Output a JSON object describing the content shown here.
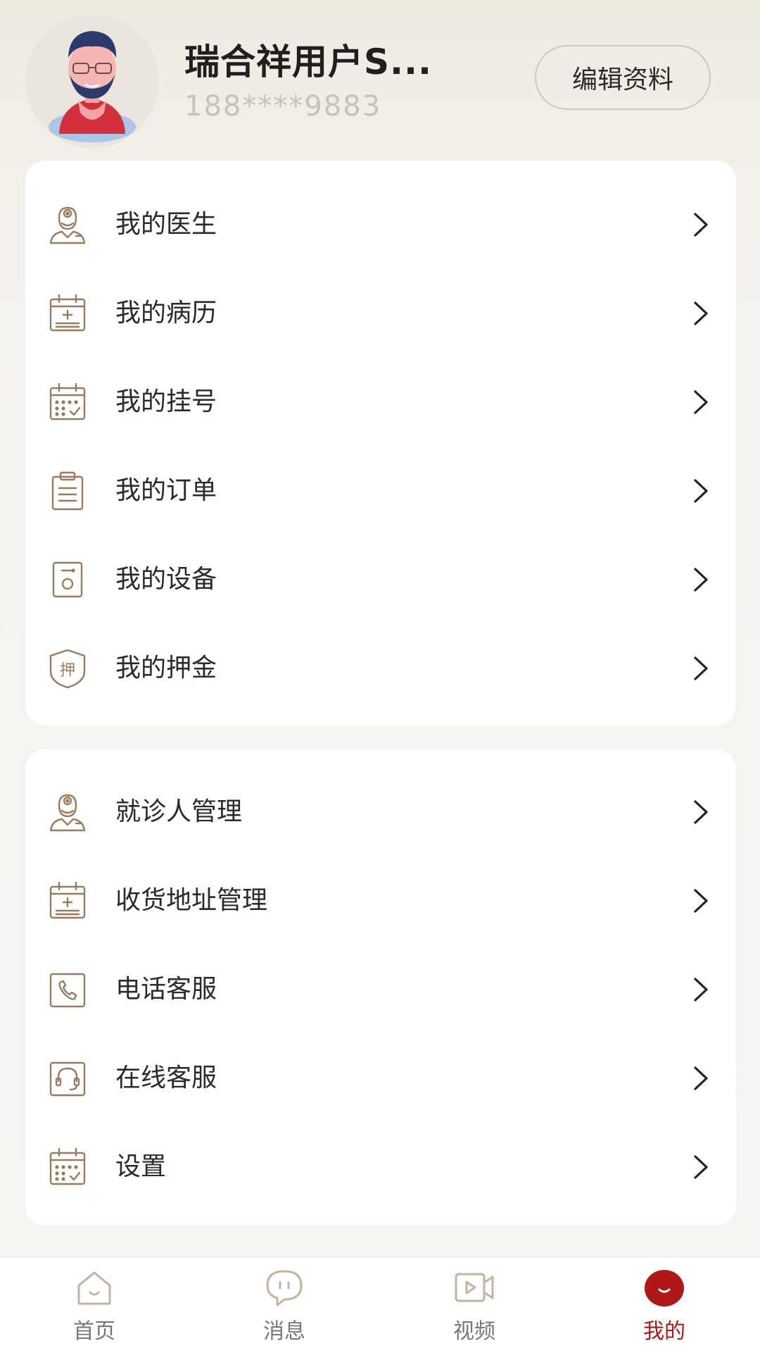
{
  "profile": {
    "username": "瑞合祥用户S...",
    "phone": "188****9883",
    "edit_label": "编辑资料"
  },
  "menu_primary": [
    {
      "label": "我的医生",
      "icon": "doctor-icon"
    },
    {
      "label": "我的病历",
      "icon": "medical-record-icon"
    },
    {
      "label": "我的挂号",
      "icon": "calendar-check-icon"
    },
    {
      "label": "我的订单",
      "icon": "clipboard-list-icon"
    },
    {
      "label": "我的设备",
      "icon": "device-speaker-icon"
    },
    {
      "label": "我的押金",
      "icon": "deposit-shield-icon"
    }
  ],
  "menu_secondary": [
    {
      "label": "就诊人管理",
      "icon": "doctor-icon"
    },
    {
      "label": "收货地址管理",
      "icon": "medical-record-icon"
    },
    {
      "label": "电话客服",
      "icon": "phone-icon"
    },
    {
      "label": "在线客服",
      "icon": "headset-icon"
    },
    {
      "label": "设置",
      "icon": "calendar-check-icon"
    }
  ],
  "deposit_icon_text": "押",
  "tabs": [
    {
      "label": "首页",
      "icon": "home-icon",
      "active": false
    },
    {
      "label": "消息",
      "icon": "message-icon",
      "active": false
    },
    {
      "label": "视频",
      "icon": "video-icon",
      "active": false
    },
    {
      "label": "我的",
      "icon": "profile-icon",
      "active": true
    }
  ],
  "colors": {
    "accent": "#b01818",
    "icon_brown": "#9a7b5e",
    "tab_icon": "#c7b29e"
  }
}
